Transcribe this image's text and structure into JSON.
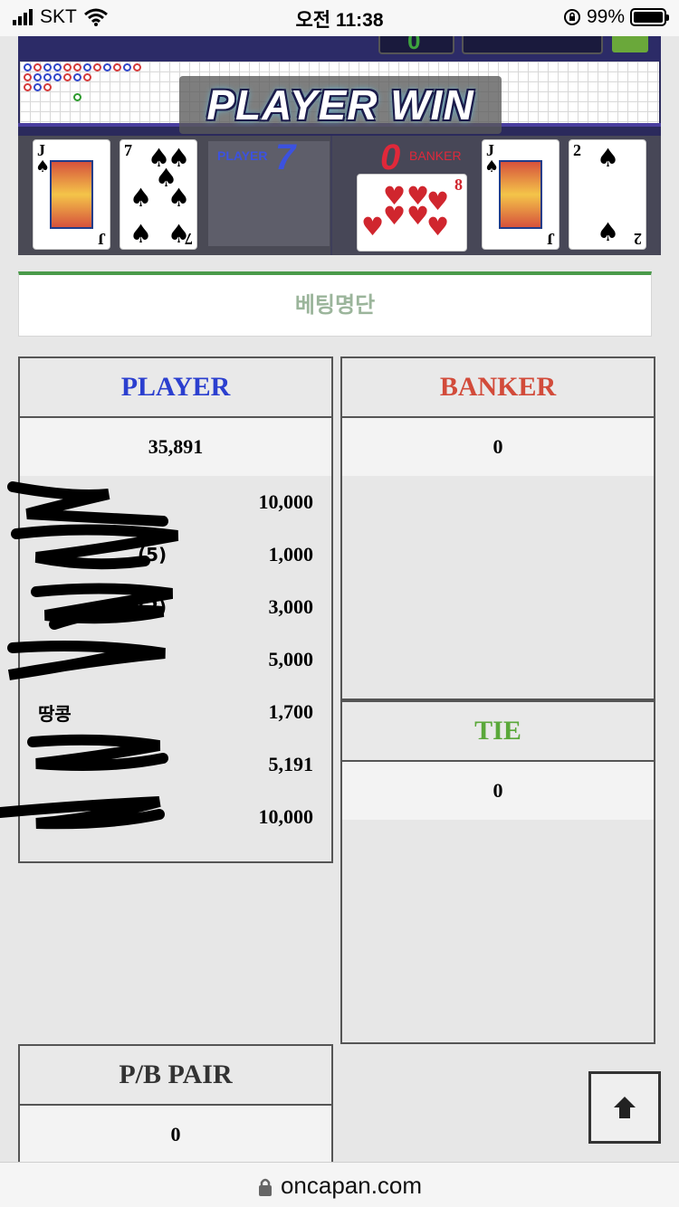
{
  "status_bar": {
    "carrier": "SKT",
    "time": "오전 11:38",
    "battery": "99%",
    "battery_level": 0.99
  },
  "game": {
    "top_counter": "0",
    "win_banner": "PLAYER WIN",
    "player_label": "PLAYER",
    "player_score": "7",
    "banker_label": "BANKER",
    "banker_score": "0",
    "player_cards": [
      {
        "rank": "J",
        "suit": "spade"
      },
      {
        "rank": "7",
        "suit": "spade"
      }
    ],
    "banker_cards": [
      {
        "rank": "8",
        "suit": "heart"
      },
      {
        "rank": "J",
        "suit": "spade"
      },
      {
        "rank": "2",
        "suit": "spade"
      }
    ]
  },
  "betting_list": {
    "title": "베팅명단"
  },
  "panels": {
    "player": {
      "header": "PLAYER",
      "header_color": "#2b3fcf",
      "total": "35,891",
      "rows": [
        {
          "name": "",
          "amount": "10,000"
        },
        {
          "name": "(5)",
          "amount": "1,000"
        },
        {
          "name": "(2)",
          "amount": "3,000"
        },
        {
          "name": "",
          "amount": "5,000"
        },
        {
          "name": "땅콩",
          "amount": "1,700"
        },
        {
          "name": "",
          "amount": "5,191"
        },
        {
          "name": "",
          "amount": "10,000"
        }
      ]
    },
    "banker": {
      "header": "BANKER",
      "header_color": "#d24b3a",
      "total": "0"
    },
    "tie": {
      "header": "TIE",
      "header_color": "#5aa83a",
      "total": "0"
    },
    "pair": {
      "header": "P/B PAIR",
      "header_color": "#333333",
      "total": "0"
    }
  },
  "url_bar": {
    "domain": "oncapan.com"
  }
}
